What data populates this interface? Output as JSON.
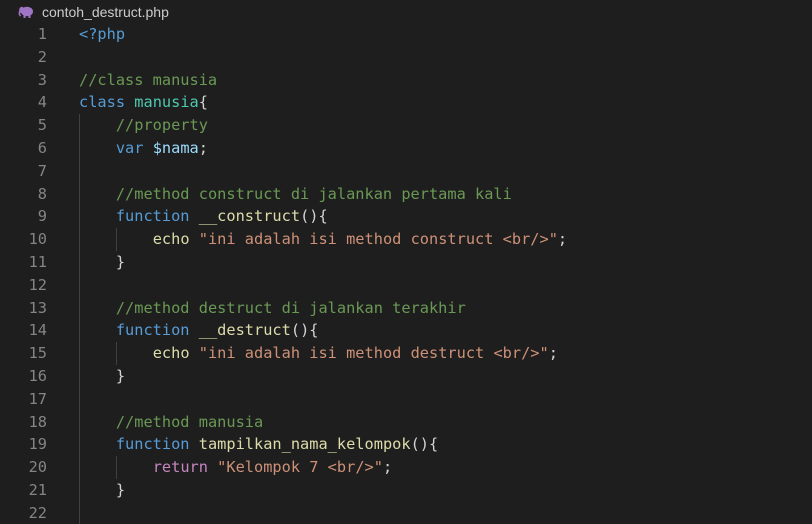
{
  "file": {
    "name": "contoh_destruct.php",
    "icon": "php-elephant-icon",
    "icon_color": "#a074c4"
  },
  "theme": {
    "background": "#1e1e1e",
    "keyword": "#569cd6",
    "control": "#c586c0",
    "class": "#4ec9b0",
    "variable": "#9cdcfe",
    "function": "#dcdcaa",
    "string": "#ce9178",
    "comment": "#6a9955",
    "line_number": "#858585"
  },
  "lines": [
    {
      "n": "1",
      "guides": 0,
      "tokens": [
        {
          "t": "<?php",
          "c": "kw"
        }
      ]
    },
    {
      "n": "2",
      "guides": 0,
      "tokens": []
    },
    {
      "n": "3",
      "guides": 0,
      "tokens": [
        {
          "t": "//class manusia",
          "c": "com"
        }
      ]
    },
    {
      "n": "4",
      "guides": 0,
      "tokens": [
        {
          "t": "class",
          "c": "kw"
        },
        {
          "t": " ",
          "c": "plain"
        },
        {
          "t": "manusia",
          "c": "cls"
        },
        {
          "t": "{",
          "c": "pun"
        }
      ]
    },
    {
      "n": "5",
      "guides": 1,
      "tokens": [
        {
          "t": "    ",
          "c": "plain"
        },
        {
          "t": "//property",
          "c": "com"
        }
      ]
    },
    {
      "n": "6",
      "guides": 1,
      "tokens": [
        {
          "t": "    ",
          "c": "plain"
        },
        {
          "t": "var",
          "c": "kw"
        },
        {
          "t": " ",
          "c": "plain"
        },
        {
          "t": "$nama",
          "c": "var"
        },
        {
          "t": ";",
          "c": "pun"
        }
      ]
    },
    {
      "n": "7",
      "guides": 1,
      "tokens": []
    },
    {
      "n": "8",
      "guides": 1,
      "tokens": [
        {
          "t": "    ",
          "c": "plain"
        },
        {
          "t": "//method construct di jalankan pertama kali",
          "c": "com"
        }
      ]
    },
    {
      "n": "9",
      "guides": 1,
      "tokens": [
        {
          "t": "    ",
          "c": "plain"
        },
        {
          "t": "function",
          "c": "kw"
        },
        {
          "t": " ",
          "c": "plain"
        },
        {
          "t": "__construct",
          "c": "fn"
        },
        {
          "t": "(){",
          "c": "pun"
        }
      ]
    },
    {
      "n": "10",
      "guides": 2,
      "tokens": [
        {
          "t": "        ",
          "c": "plain"
        },
        {
          "t": "echo",
          "c": "fn"
        },
        {
          "t": " ",
          "c": "plain"
        },
        {
          "t": "\"ini adalah isi method construct <br/>\"",
          "c": "str"
        },
        {
          "t": ";",
          "c": "pun"
        }
      ]
    },
    {
      "n": "11",
      "guides": 1,
      "tokens": [
        {
          "t": "    ",
          "c": "plain"
        },
        {
          "t": "}",
          "c": "pun"
        }
      ]
    },
    {
      "n": "12",
      "guides": 1,
      "tokens": []
    },
    {
      "n": "13",
      "guides": 1,
      "tokens": [
        {
          "t": "    ",
          "c": "plain"
        },
        {
          "t": "//method destruct di jalankan terakhir",
          "c": "com"
        }
      ]
    },
    {
      "n": "14",
      "guides": 1,
      "tokens": [
        {
          "t": "    ",
          "c": "plain"
        },
        {
          "t": "function",
          "c": "kw"
        },
        {
          "t": " ",
          "c": "plain"
        },
        {
          "t": "__destruct",
          "c": "fn"
        },
        {
          "t": "(){",
          "c": "pun"
        }
      ]
    },
    {
      "n": "15",
      "guides": 2,
      "tokens": [
        {
          "t": "        ",
          "c": "plain"
        },
        {
          "t": "echo",
          "c": "fn"
        },
        {
          "t": " ",
          "c": "plain"
        },
        {
          "t": "\"ini adalah isi method destruct <br/>\"",
          "c": "str"
        },
        {
          "t": ";",
          "c": "pun"
        }
      ]
    },
    {
      "n": "16",
      "guides": 1,
      "tokens": [
        {
          "t": "    ",
          "c": "plain"
        },
        {
          "t": "}",
          "c": "pun"
        }
      ]
    },
    {
      "n": "17",
      "guides": 1,
      "tokens": []
    },
    {
      "n": "18",
      "guides": 1,
      "tokens": [
        {
          "t": "    ",
          "c": "plain"
        },
        {
          "t": "//method manusia",
          "c": "com"
        }
      ]
    },
    {
      "n": "19",
      "guides": 1,
      "tokens": [
        {
          "t": "    ",
          "c": "plain"
        },
        {
          "t": "function",
          "c": "kw"
        },
        {
          "t": " ",
          "c": "plain"
        },
        {
          "t": "tampilkan_nama_kelompok",
          "c": "fn"
        },
        {
          "t": "(){",
          "c": "pun"
        }
      ]
    },
    {
      "n": "20",
      "guides": 2,
      "tokens": [
        {
          "t": "        ",
          "c": "plain"
        },
        {
          "t": "return",
          "c": "ctrl"
        },
        {
          "t": " ",
          "c": "plain"
        },
        {
          "t": "\"Kelompok 7 <br/>\"",
          "c": "str"
        },
        {
          "t": ";",
          "c": "pun"
        }
      ]
    },
    {
      "n": "21",
      "guides": 1,
      "tokens": [
        {
          "t": "    ",
          "c": "plain"
        },
        {
          "t": "}",
          "c": "pun"
        }
      ]
    },
    {
      "n": "22",
      "guides": 1,
      "tokens": []
    }
  ]
}
